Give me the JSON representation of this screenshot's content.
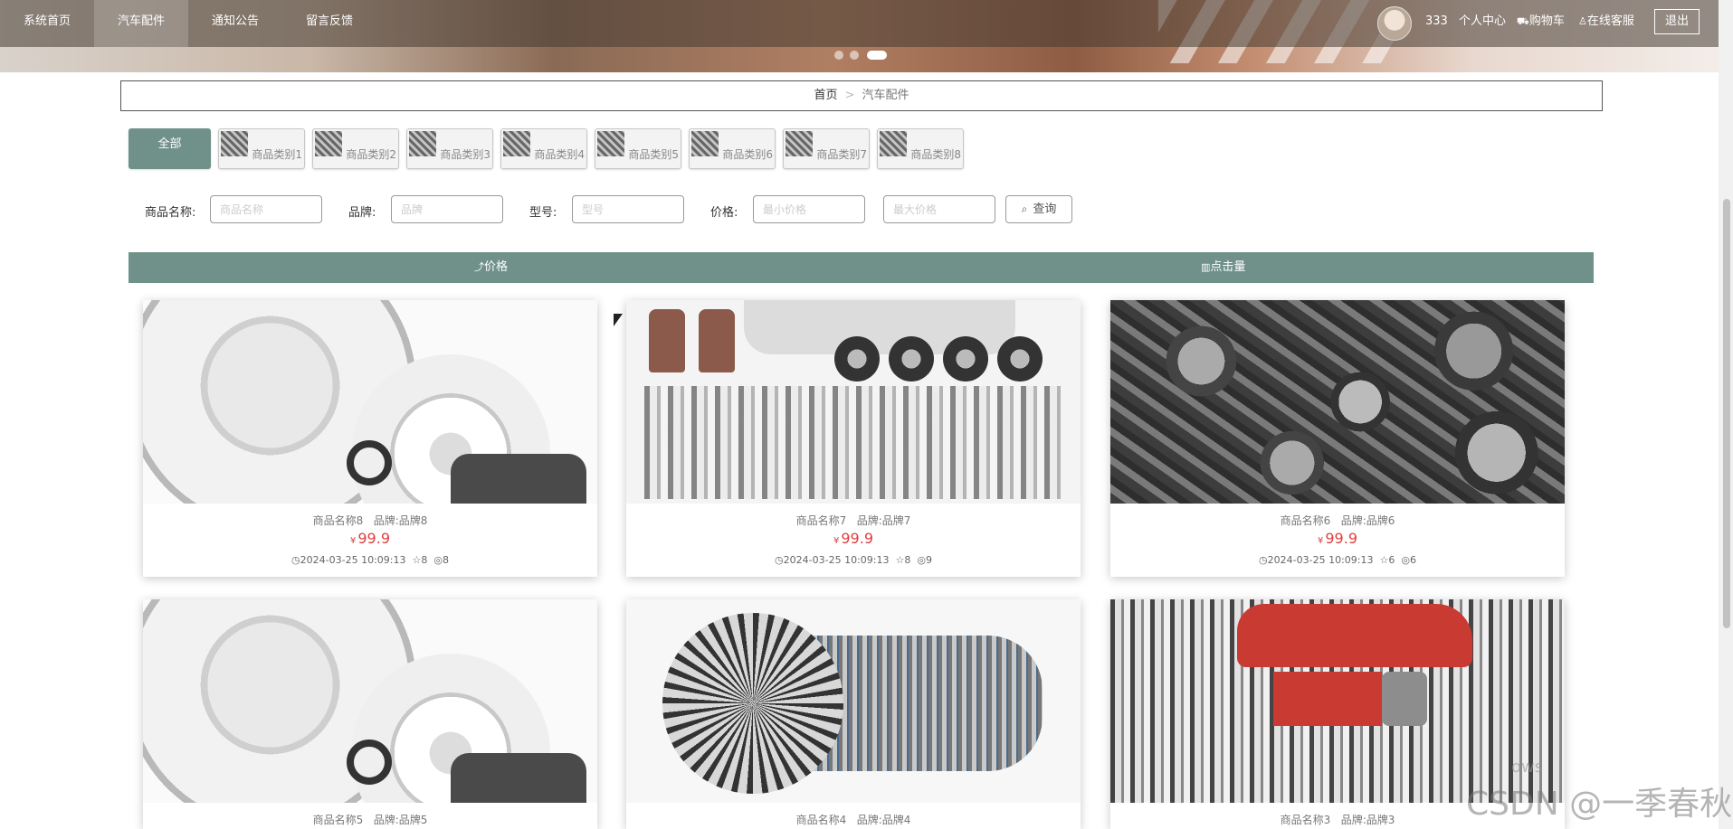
{
  "nav": {
    "items": [
      {
        "label": "系统首页"
      },
      {
        "label": "汽车配件",
        "active": true
      },
      {
        "label": "通知公告"
      },
      {
        "label": "留言反馈"
      }
    ],
    "user": {
      "name": "333",
      "profile_label": "个人中心",
      "cart_label": "购物车",
      "service_label": "在线客服",
      "logout_label": "退出"
    },
    "carousel_active_index": 2
  },
  "breadcrumb": {
    "home": "首页",
    "separator": ">",
    "current": "汽车配件"
  },
  "categories": [
    {
      "label": "全部",
      "active": true
    },
    {
      "label": "商品类别1"
    },
    {
      "label": "商品类别2"
    },
    {
      "label": "商品类别3"
    },
    {
      "label": "商品类别4"
    },
    {
      "label": "商品类别5"
    },
    {
      "label": "商品类别6"
    },
    {
      "label": "商品类别7"
    },
    {
      "label": "商品类别8"
    }
  ],
  "filters": {
    "name_label": "商品名称:",
    "name_placeholder": "商品名称",
    "brand_label": "品牌:",
    "brand_placeholder": "品牌",
    "model_label": "型号:",
    "model_placeholder": "型号",
    "price_label": "价格:",
    "min_price_placeholder": "最小价格",
    "max_price_placeholder": "最大价格",
    "search_label": "查询"
  },
  "sort": {
    "price_label": "价格",
    "clicks_label": "点击量"
  },
  "products": [
    {
      "title": "商品名称8",
      "brand": "品牌:品牌8",
      "currency": "¥",
      "price": "99.9",
      "date": "2024-03-25 10:09:13",
      "likes": "8",
      "views": "8",
      "image": "brake-rotor"
    },
    {
      "title": "商品名称7",
      "brand": "品牌:品牌7",
      "currency": "¥",
      "price": "99.9",
      "date": "2024-03-25 10:09:13",
      "likes": "8",
      "views": "9",
      "image": "car-parts-kit"
    },
    {
      "title": "商品名称6",
      "brand": "品牌:品牌6",
      "currency": "¥",
      "price": "99.9",
      "date": "2024-03-25 10:09:13",
      "likes": "6",
      "views": "6",
      "image": "cast-parts"
    },
    {
      "title": "商品名称5",
      "brand": "品牌:品牌5",
      "image": "brake-rotor"
    },
    {
      "title": "商品名称4",
      "brand": "品牌:品牌4",
      "image": "turbine-engine"
    },
    {
      "title": "商品名称3",
      "brand": "品牌:品牌3",
      "image": "exploded-car"
    }
  ],
  "overlay": {
    "watermark": "CSDN @一季春秋",
    "windows_text": "ows"
  },
  "colors": {
    "accent": "#6f9189",
    "price": "#e03e3e",
    "nav_overlay": "rgba(70,58,50,.55)"
  }
}
